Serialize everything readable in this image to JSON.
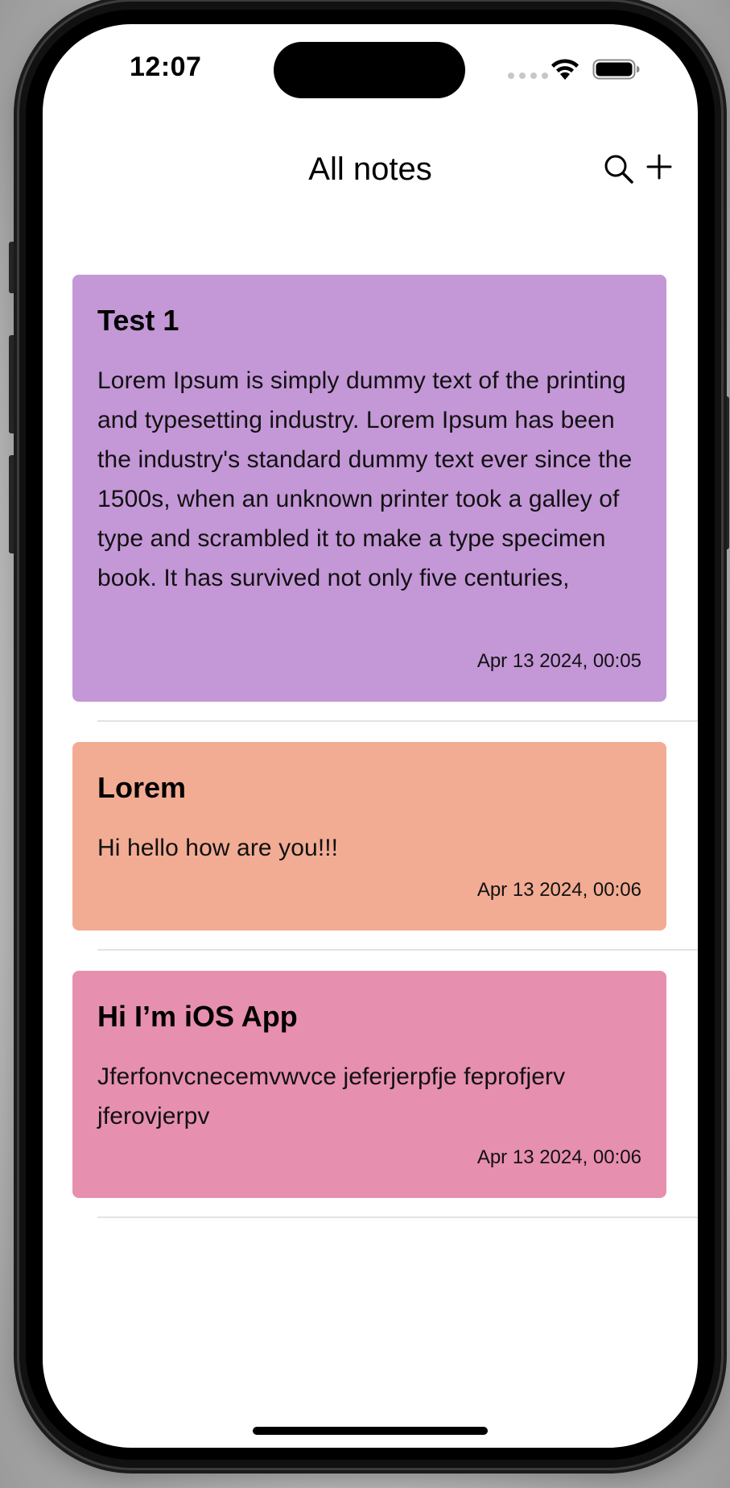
{
  "status_bar": {
    "time": "12:07",
    "icons": [
      "signal-icon",
      "wifi-icon",
      "battery-icon"
    ]
  },
  "nav": {
    "title": "All notes",
    "actions": [
      "search-icon",
      "plus-icon"
    ]
  },
  "notes": [
    {
      "title": "Test 1",
      "body": "Lorem Ipsum is simply dummy text of the printing and typesetting industry. Lorem Ipsum has been the industry's standard dummy text ever since the 1500s, when an unknown printer took a galley of type and scrambled it to make a type specimen book. It has survived not only five centuries,",
      "date": "Apr 13 2024, 00:05",
      "color": "#C497D7"
    },
    {
      "title": "Lorem",
      "body": "Hi hello how are you!!!",
      "date": "Apr 13 2024, 00:06",
      "color": "#F2AC93"
    },
    {
      "title": "Hi I’m iOS App",
      "body": "Jferfonvcnecemvwvce jeferjerpfje feprofjerv jferovjerpv",
      "date": "Apr 13 2024, 00:06",
      "color": "#E78FAE"
    }
  ]
}
